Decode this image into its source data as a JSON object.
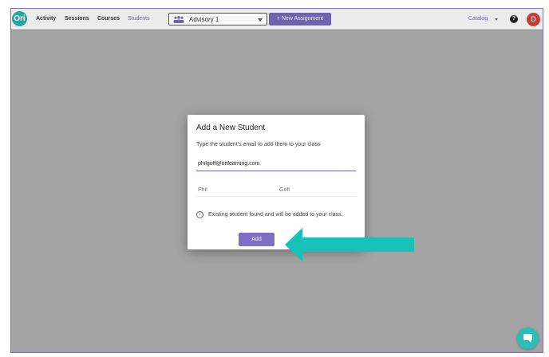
{
  "header": {
    "logo_text": "Ori",
    "nav": [
      {
        "label": "Activity"
      },
      {
        "label": "Sessions"
      },
      {
        "label": "Courses"
      },
      {
        "label": "Students"
      }
    ],
    "class_select": {
      "value": "Advisory 1"
    },
    "new_assignment_label": "+  New Assignment",
    "catalog_label": "Catalog",
    "help_label": "?",
    "avatar_initial": "D"
  },
  "dialog": {
    "title": "Add a New Student",
    "description": "Type the student's email to add them to your class",
    "email_value": "philgoff@orilearning.com",
    "first_name_placeholder": "Phil",
    "last_name_placeholder": "Goff",
    "info_icon": "i",
    "info_text": "Existing student found and will be added to your class.",
    "add_label": "Add"
  },
  "colors": {
    "accent": "#6f63ae",
    "arrow": "#18c2b8",
    "chat": "#25c0b8",
    "avatar": "#c43c39"
  }
}
